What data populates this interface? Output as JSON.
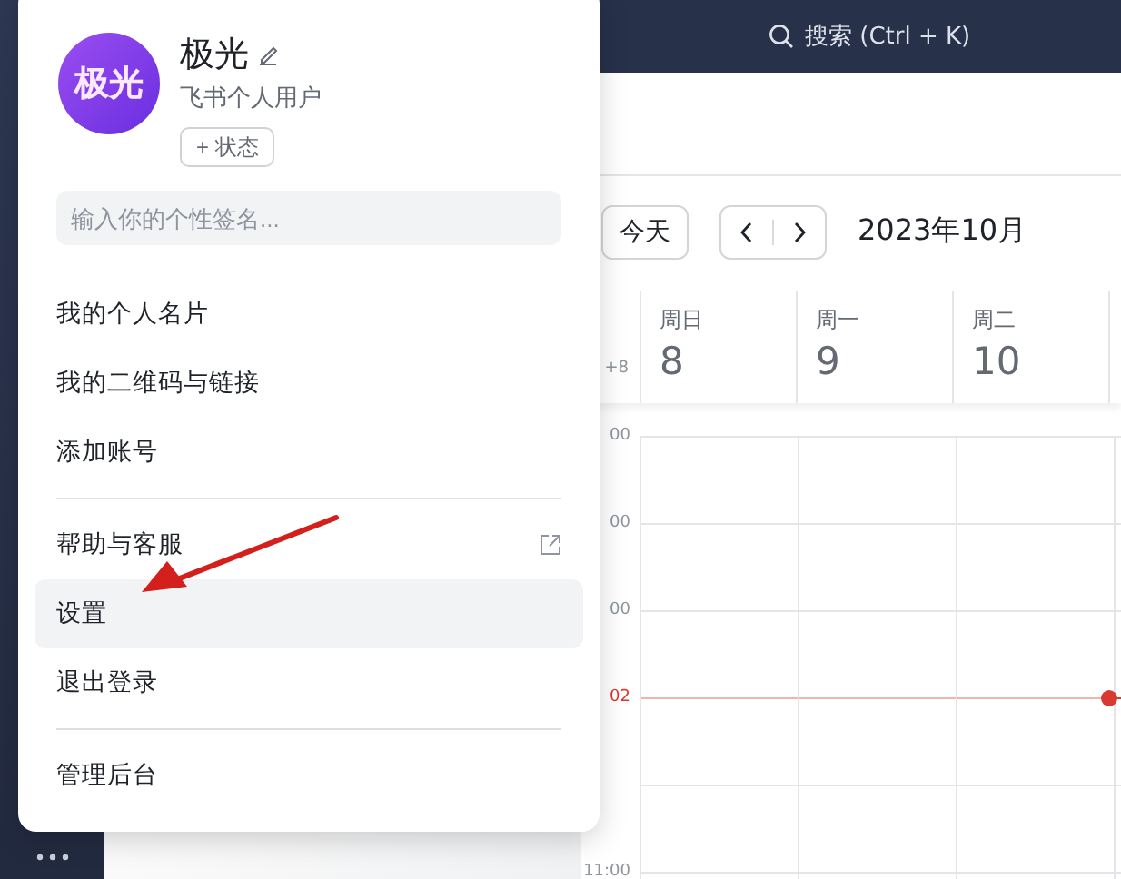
{
  "topbar": {
    "search_label": "搜索 (Ctrl + K)"
  },
  "calendar": {
    "today_button": "今天",
    "month": "2023年10月",
    "timezone": "+8",
    "days": [
      {
        "weekday": "周日",
        "date": "8"
      },
      {
        "weekday": "周一",
        "date": "9"
      },
      {
        "weekday": "周二",
        "date": "10"
      }
    ],
    "time_rows": [
      {
        "label": "00",
        "current": false
      },
      {
        "label": "00",
        "current": false
      },
      {
        "label": "00",
        "current": false
      },
      {
        "label": "02",
        "current": true
      },
      {
        "current": false
      },
      {
        "label": "11:00",
        "current": false
      }
    ]
  },
  "profile_menu": {
    "avatar_text": "极光",
    "name": "极光",
    "subtitle": "飞书个人用户",
    "status_button": "+ 状态",
    "signature_placeholder": "输入你的个性签名...",
    "groups": [
      [
        {
          "label": "我的个人名片",
          "external": false,
          "highlighted": false
        },
        {
          "label": "我的二维码与链接",
          "external": false,
          "highlighted": false
        },
        {
          "label": "添加账号",
          "external": false,
          "highlighted": false
        }
      ],
      [
        {
          "label": "帮助与客服",
          "external": true,
          "highlighted": false
        },
        {
          "label": "设置",
          "external": false,
          "highlighted": true
        },
        {
          "label": "退出登录",
          "external": false,
          "highlighted": false
        }
      ],
      [
        {
          "label": "管理后台",
          "external": false,
          "highlighted": false
        }
      ]
    ]
  }
}
